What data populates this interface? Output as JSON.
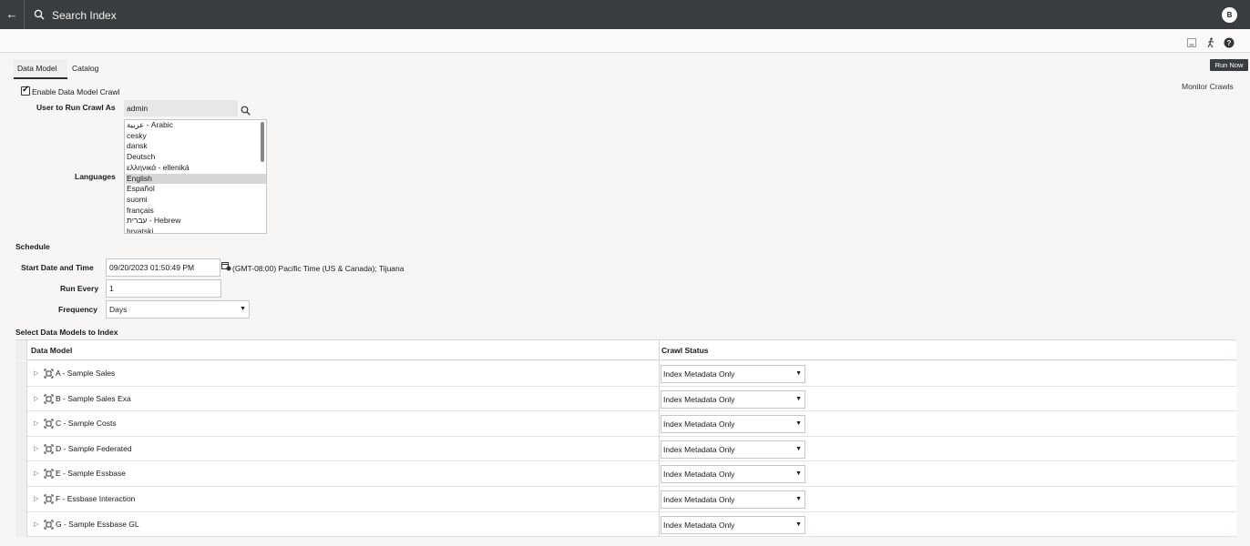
{
  "header": {
    "title": "Search Index",
    "avatar_initial": "B"
  },
  "toolbar": {
    "tooltip": "Run Now"
  },
  "tabs": [
    {
      "label": "Data Model"
    },
    {
      "label": "Catalog"
    }
  ],
  "monitor_link": "Monitor Crawls",
  "crawl": {
    "enable_label": "Enable Data Model Crawl",
    "enabled": true,
    "user_label": "User to Run Crawl As",
    "user_value": "admin",
    "languages_label": "Languages",
    "languages": [
      "عربية - Arabic",
      "cesky",
      "dansk",
      "Deutsch",
      "ελληνικά - elleniká",
      "English",
      "Español",
      "suomi",
      "français",
      "עברית - Hebrew",
      "hrvatski"
    ],
    "selected_language": "English"
  },
  "schedule": {
    "heading": "Schedule",
    "start_label": "Start Date and Time",
    "start_value": "09/20/2023 01:50:49 PM",
    "timezone": "(GMT-08:00) Pacific Time (US & Canada); Tijuana",
    "run_every_label": "Run Every",
    "run_every_value": "1",
    "frequency_label": "Frequency",
    "frequency_value": "Days"
  },
  "models": {
    "heading": "Select Data Models to Index",
    "col_model": "Data Model",
    "col_status": "Crawl Status",
    "rows": [
      {
        "name": "A - Sample Sales",
        "status": "Index Metadata Only"
      },
      {
        "name": "B - Sample Sales Exa",
        "status": "Index Metadata Only"
      },
      {
        "name": "C - Sample Costs",
        "status": "Index Metadata Only"
      },
      {
        "name": "D - Sample Federated",
        "status": "Index Metadata Only"
      },
      {
        "name": "E - Sample Essbase",
        "status": "Index Metadata Only"
      },
      {
        "name": "F - Essbase Interaction",
        "status": "Index Metadata Only"
      },
      {
        "name": "G - Sample Essbase GL",
        "status": "Index Metadata Only"
      }
    ]
  }
}
